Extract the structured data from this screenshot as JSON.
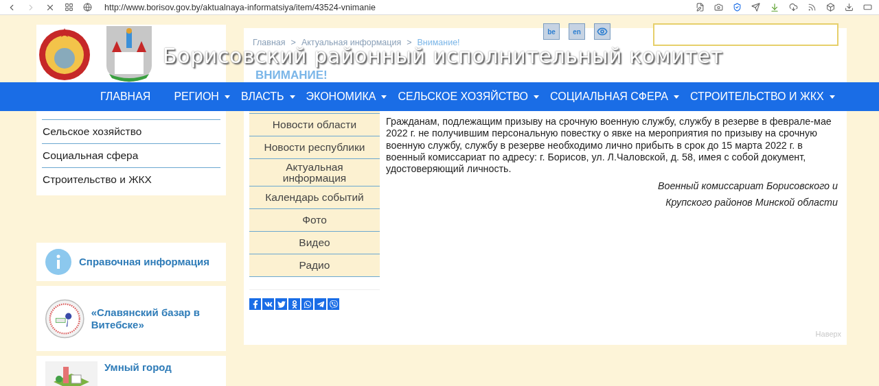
{
  "browser": {
    "url": "http://www.borisov.gov.by/aktualnaya-informatsiya/item/43524-vnimanie"
  },
  "header": {
    "title": "Борисовский районный исполнительный комитет",
    "languages": [
      "be",
      "en"
    ]
  },
  "breadcrumb": [
    {
      "label": "Главная"
    },
    {
      "separator": ">",
      "label": "Актуальная информация"
    },
    {
      "separator": ">",
      "label": "Внимание!"
    }
  ],
  "heading": "ВНИМАНИЕ!",
  "nav": [
    {
      "label": "ГЛАВНАЯ",
      "dropdown": false
    },
    {
      "label": "РЕГИОН",
      "dropdown": true
    },
    {
      "label": "ВЛАСТЬ",
      "dropdown": true
    },
    {
      "label": "ЭКОНОМИКА",
      "dropdown": true
    },
    {
      "label": "СЕЛЬСКОЕ ХОЗЯЙСТВО",
      "dropdown": true
    },
    {
      "label": "СОЦИАЛЬНАЯ СФЕРА",
      "dropdown": true
    },
    {
      "label": "СТРОИТЕЛЬСТВО И ЖКХ",
      "dropdown": true
    }
  ],
  "sidebar": {
    "items": [
      "Сельское хозяйство",
      "Социальная сфера",
      "Строительство и ЖКХ"
    ]
  },
  "banners": [
    {
      "kind": "info",
      "label": "Справочная информация"
    },
    {
      "kind": "festival",
      "label": "«Славянский базар в Витебске»"
    },
    {
      "kind": "city",
      "label": "Умный город"
    }
  ],
  "submenu": [
    "Новости области",
    "Новости республики",
    "Актуальная информация",
    "Календарь событий",
    "Фото",
    "Видео",
    "Радио"
  ],
  "article": {
    "text": "Гражданам, подлежащим призыву на срочную военную службу, службу в резерве в феврале-мае 2022 г. не получившим персональную повестку о явке на мероприятия по призыву на срочную военную службу, службу в резерве необходимо лично прибыть в срок до 15 марта 2022 г. в военный комиссариат по адресу: г. Борисов, ул. Л.Чаловской, д. 58, имея с собой документ, удостоверяющий личность.",
    "signature": [
      "Военный комиссариат Борисовского и",
      "Крупского районов Минской области"
    ]
  },
  "back_to_top": "Наверх"
}
